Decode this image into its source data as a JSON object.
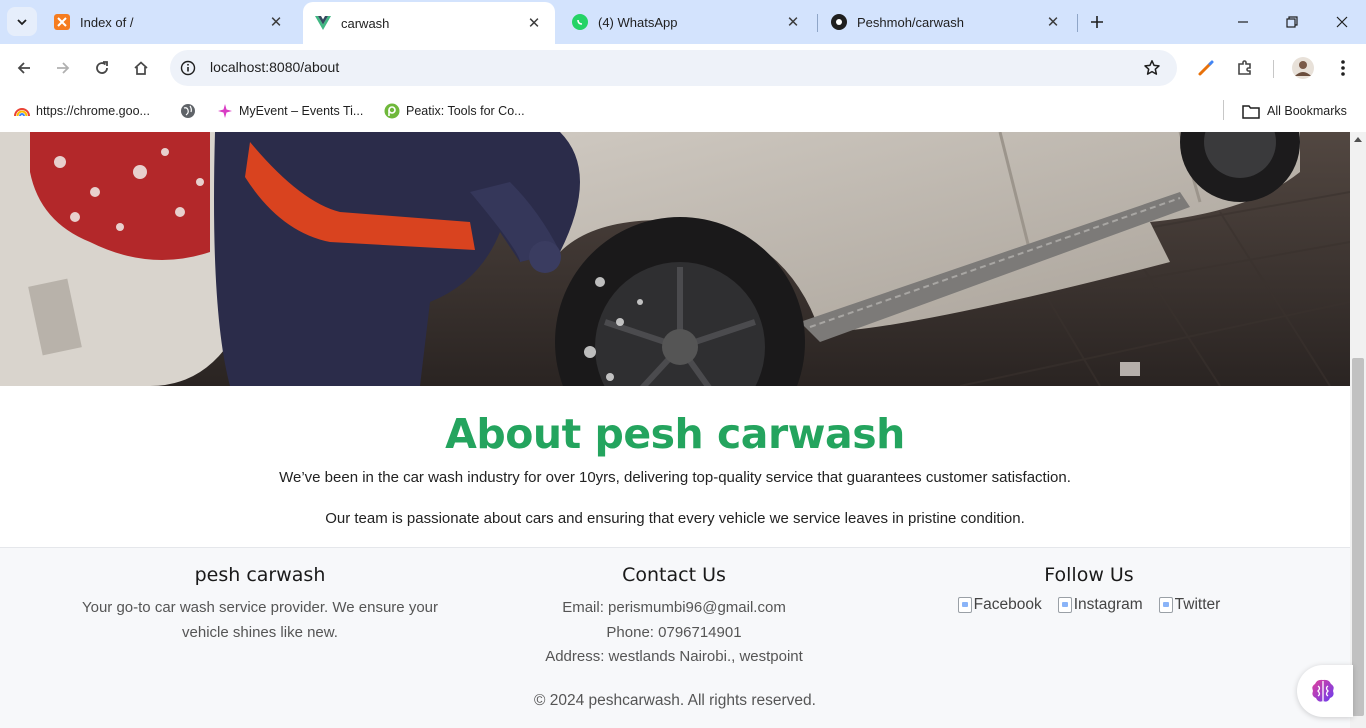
{
  "browser": {
    "tabs": [
      {
        "title": "Index of /",
        "favicon": "xampp-icon",
        "active": false
      },
      {
        "title": "carwash",
        "favicon": "vue-icon",
        "active": true
      },
      {
        "title": "(4) WhatsApp",
        "favicon": "whatsapp-icon",
        "active": false
      },
      {
        "title": "Peshmoh/carwash",
        "favicon": "github-icon",
        "active": false
      }
    ],
    "url": "localhost:8080/about",
    "bookmarks": [
      {
        "label": "https://chrome.goo...",
        "icon": "rainbow-icon"
      },
      {
        "label": "",
        "icon": "globe-icon"
      },
      {
        "label": "MyEvent – Events Ti...",
        "icon": "myevent-icon"
      },
      {
        "label": "Peatix: Tools for Co...",
        "icon": "peatix-icon"
      }
    ],
    "all_bookmarks_label": "All Bookmarks"
  },
  "about": {
    "title": "About pesh carwash",
    "paragraph1": "We’ve been in the car wash industry for over 10yrs, delivering top-quality service that guarantees customer satisfaction.",
    "paragraph2": "Our team is passionate about cars and ensuring that every vehicle we service leaves in pristine condition."
  },
  "footer": {
    "brand": {
      "title": "pesh carwash",
      "description_line1": "Your go-to car wash service provider. We ensure your",
      "description_line2": "vehicle shines like new."
    },
    "contact": {
      "title": "Contact Us",
      "email": "Email: perismumbi96@gmail.com",
      "phone": "Phone: 0796714901",
      "address": "Address: westlands Nairobi., westpoint"
    },
    "follow": {
      "title": "Follow Us",
      "links": [
        "Facebook",
        "Instagram",
        "Twitter"
      ]
    },
    "copyright": "© 2024 peshcarwash. All rights reserved."
  },
  "colors": {
    "accent_green": "#24a45e",
    "tabstrip": "#d3e3fd"
  }
}
